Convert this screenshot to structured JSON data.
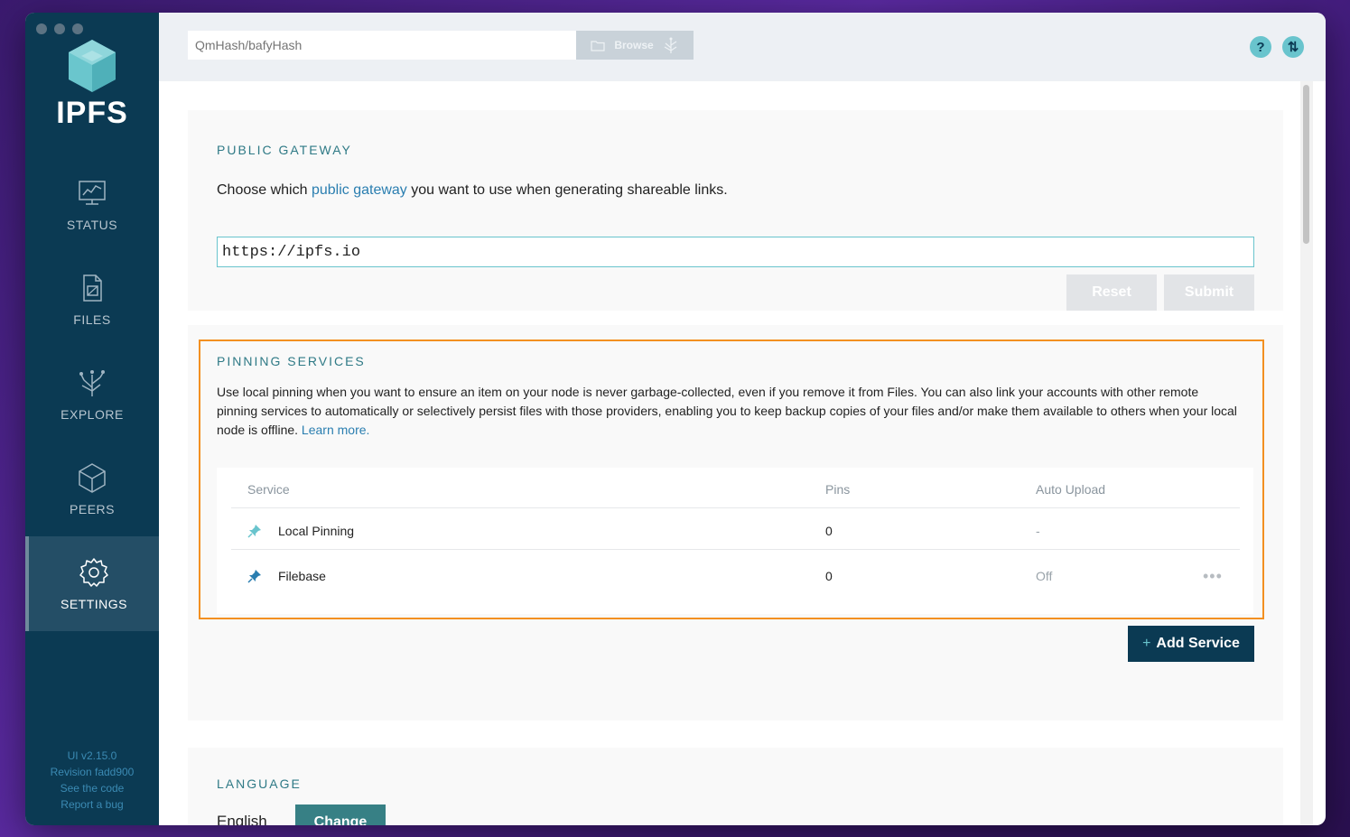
{
  "app": {
    "name": "IPFS",
    "version": "UI v2.15.0",
    "revision": "Revision fadd900",
    "see_code": "See the code",
    "report_bug": "Report a bug"
  },
  "nav": [
    {
      "label": "STATUS",
      "icon": "status-icon",
      "active": false
    },
    {
      "label": "FILES",
      "icon": "files-icon",
      "active": false
    },
    {
      "label": "EXPLORE",
      "icon": "explore-icon",
      "active": false
    },
    {
      "label": "PEERS",
      "icon": "peers-icon",
      "active": false
    },
    {
      "label": "SETTINGS",
      "icon": "settings-icon",
      "active": true
    }
  ],
  "topbar": {
    "hash_placeholder": "QmHash/bafyHash",
    "browse_label": "Browse"
  },
  "gateway": {
    "title": "PUBLIC GATEWAY",
    "desc_before": "Choose which ",
    "desc_link": "public gateway",
    "desc_after": " you want to use when generating shareable links.",
    "value": "https://ipfs.io",
    "reset_label": "Reset",
    "submit_label": "Submit"
  },
  "pinning": {
    "title": "PINNING SERVICES",
    "description": "Use local pinning when you want to ensure an item on your node is never garbage-collected, even if you remove it from Files. You can also link your accounts with other remote pinning services to automatically or selectively persist files with those providers, enabling you to keep backup copies of your files and/or make them available to others when your local node is offline. ",
    "learn_more": "Learn more.",
    "columns": {
      "service": "Service",
      "pins": "Pins",
      "auto_upload": "Auto Upload"
    },
    "rows": [
      {
        "service": "Local Pinning",
        "pins": "0",
        "auto_upload": "-"
      },
      {
        "service": "Filebase",
        "pins": "0",
        "auto_upload": "Off",
        "more": "•••"
      }
    ],
    "add_label": "Add Service",
    "add_plus": "+"
  },
  "language": {
    "title": "LANGUAGE",
    "value": "English",
    "change_label": "Change"
  },
  "colors": {
    "sidebar": "#0b3a53",
    "accent": "#69c4cd",
    "highlight_border": "#f39021",
    "link": "#2a7eb0"
  }
}
